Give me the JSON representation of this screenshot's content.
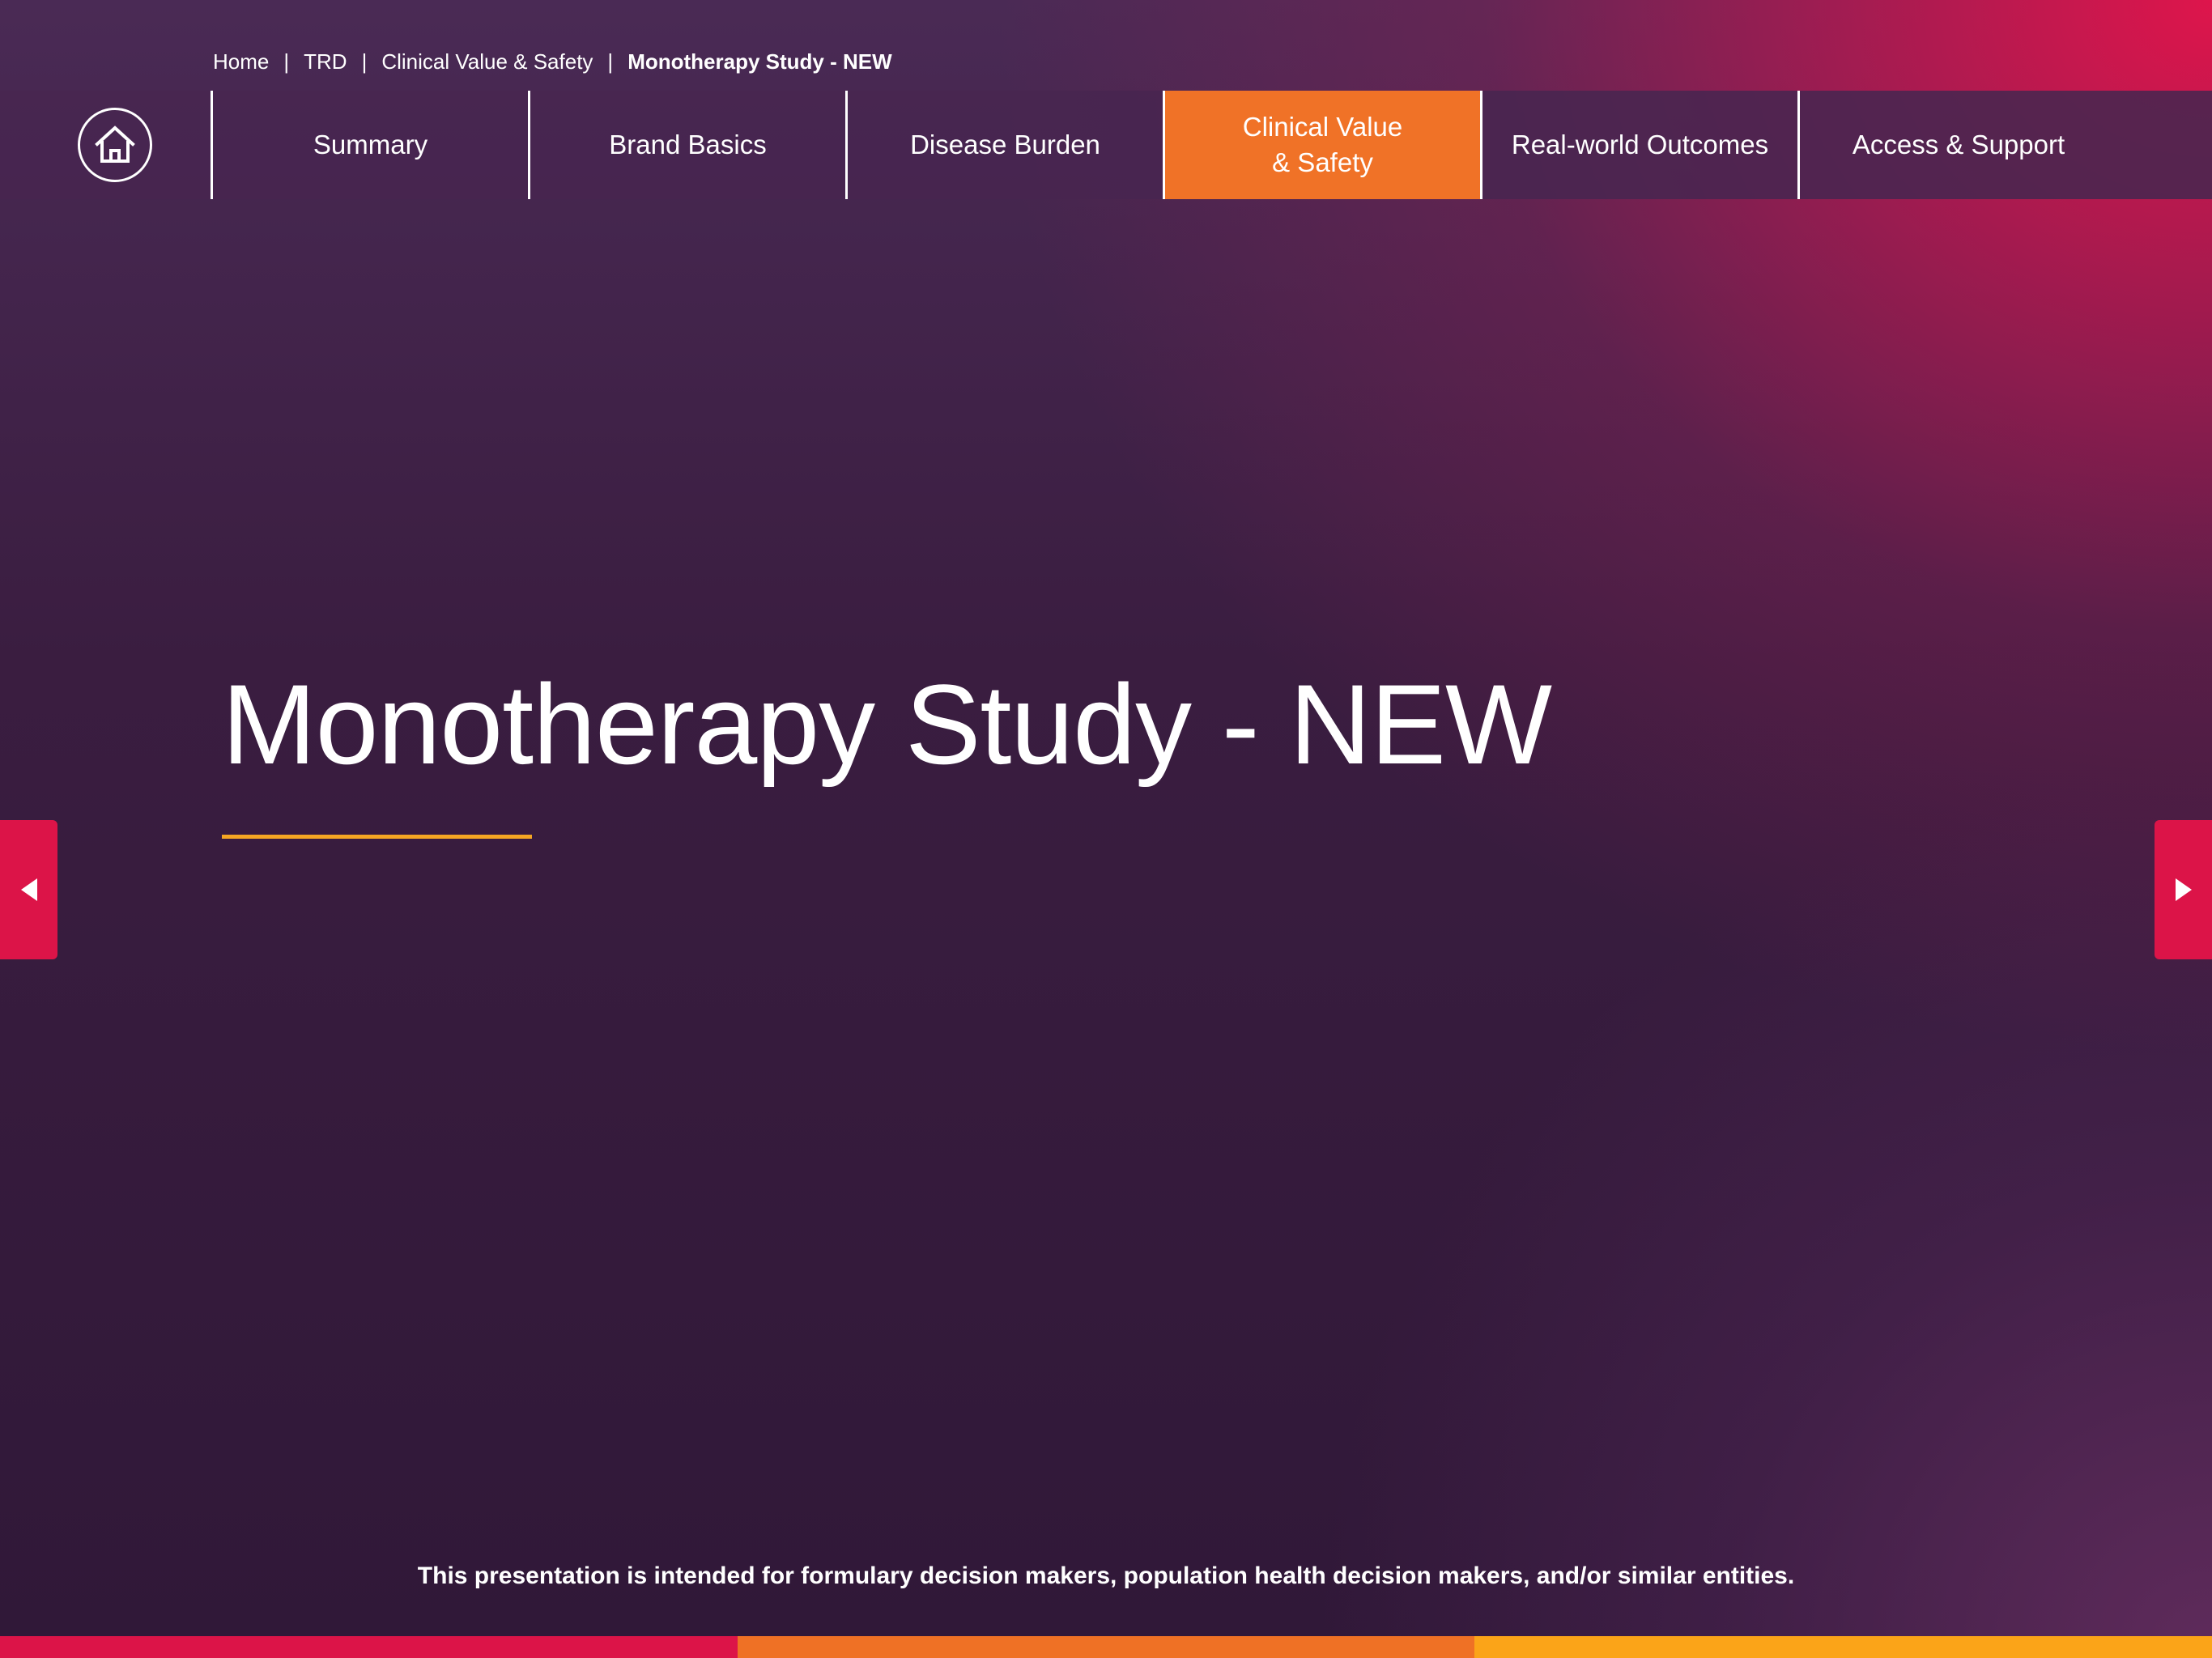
{
  "breadcrumb": {
    "items": [
      "Home",
      "TRD",
      "Clinical Value & Safety",
      "Monotherapy Study - NEW"
    ],
    "separator": "|"
  },
  "nav": {
    "home_icon": "home-icon",
    "tabs": [
      {
        "label": "Summary",
        "active": false
      },
      {
        "label": "Brand Basics",
        "active": false
      },
      {
        "label": "Disease Burden",
        "active": false
      },
      {
        "label": "Clinical Value\n& Safety",
        "active": true
      },
      {
        "label": "Real-world Outcomes",
        "active": false
      },
      {
        "label": "Access & Support",
        "active": false
      }
    ]
  },
  "main": {
    "title": "Monotherapy Study - NEW"
  },
  "arrows": {
    "prev_icon": "triangle-left-icon",
    "next_icon": "triangle-right-icon"
  },
  "footer": {
    "disclaimer": "This presentation is intended for formulary decision makers, population health decision makers, and/or similar entities."
  },
  "colors": {
    "active_tab": "#f07227",
    "accent_rule": "#f5a623",
    "arrow_bg": "#dc1448",
    "stripe": [
      "#dc1448",
      "#ef7125",
      "#fba418"
    ]
  }
}
